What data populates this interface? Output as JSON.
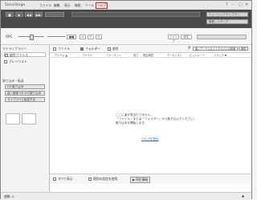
{
  "window": {
    "title": "SonicStage",
    "controls": [
      "?",
      "–",
      "□",
      "✕"
    ]
  },
  "menu": [
    {
      "label": "ファイル"
    },
    {
      "label": "編集"
    },
    {
      "label": "表示"
    },
    {
      "label": "機能"
    },
    {
      "label": "ツール"
    },
    {
      "label": "ヘルプ"
    }
  ],
  "transport": {
    "buttons": [
      "■",
      "▶",
      "◀◀",
      "▶▶"
    ],
    "right_labels": [
      "ミュージックライブラリ",
      "機器 / メディア"
    ]
  },
  "toolbar2": {
    "opc_label": "OPC",
    "mode_label": "■■",
    "icons": [
      "≡",
      "⊟",
      "⊡"
    ],
    "right_buttons": [
      "ジャンプ",
      "設定"
    ]
  },
  "sidebar": {
    "header": "マイライブラリー",
    "items": [
      "曲目ファイル",
      "プレーリスト"
    ],
    "section": "取り込み・転送",
    "buttons": [
      "CD 取り込み",
      "曲 / 音楽 CD から取り込み",
      "ライブラリに転送する"
    ]
  },
  "main": {
    "tabs": [
      "ファイル",
      "フォルダー",
      "曲名"
    ],
    "search_placeholder": "曲 / アーティスト / アルバムの検索",
    "clear_label": "消去",
    "columns": [
      "アイテム ▲",
      "ファイル",
      "フォーマット",
      "長さ",
      "再生時間",
      "アーティスト",
      "ビットレート",
      "トラック ▼"
    ],
    "empty_message": [
      "ここに曲が見当たりません。",
      "「ファイル」または「フォルダー」から取り込んでください。",
      "取り込みを開始します。"
    ],
    "link": "ヘルプを表示"
  },
  "footer": {
    "checkboxes": [
      "すべて表示",
      "個別の設定を使用"
    ],
    "button": "▶ 再生開始"
  },
  "status": {
    "label": "曲数: 0",
    "right": "▲"
  }
}
